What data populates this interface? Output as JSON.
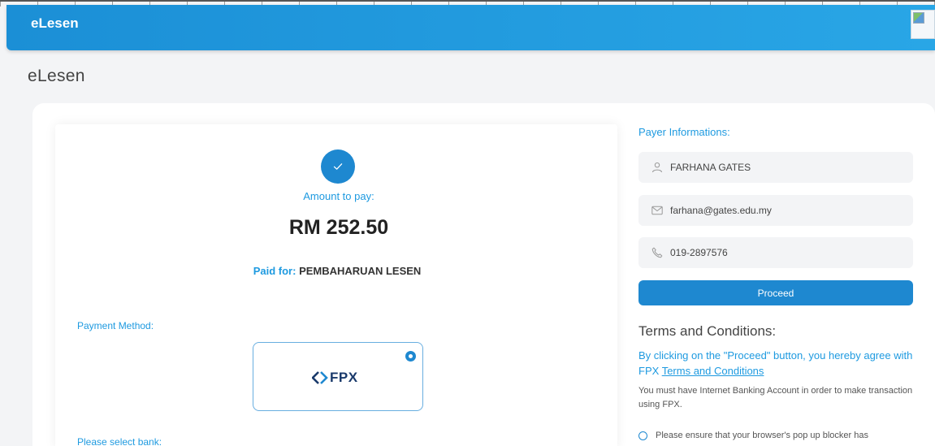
{
  "app": {
    "title": "eLesen"
  },
  "page": {
    "title": "eLesen"
  },
  "payment": {
    "amount_label": "Amount to pay:",
    "amount": "RM 252.50",
    "paid_for_label": "Paid for:",
    "paid_for_value": "PEMBAHARUAN LESEN",
    "method_label": "Payment Method:",
    "method_name": "FPX",
    "method_selected": true,
    "bank_label": "Please select bank:"
  },
  "payer": {
    "title": "Payer Informations:",
    "name": "FARHANA GATES",
    "email": "farhana@gates.edu.my",
    "phone": "019-2897576"
  },
  "actions": {
    "proceed_label": "Proceed"
  },
  "terms": {
    "title": "Terms and Conditions:",
    "lead_text": "By clicking on the \"Proceed\" button, you hereby agree with FPX",
    "link_text": "Terms and Conditions",
    "note": "You must have Internet Banking Account in order to make transaction using FPX.",
    "bullet": "Please ensure that your browser's pop up blocker has"
  },
  "colors": {
    "primary": "#1e88d0",
    "accent_text": "#1e9ae0",
    "header_start": "#1b8fd6",
    "header_end": "#29a6e6",
    "fpx_logo": "#1a3a6b"
  },
  "icons": {
    "success": "check-icon",
    "name_field": "user-icon",
    "email_field": "mail-icon",
    "phone_field": "phone-icon",
    "broken_image": "broken-image-icon"
  }
}
